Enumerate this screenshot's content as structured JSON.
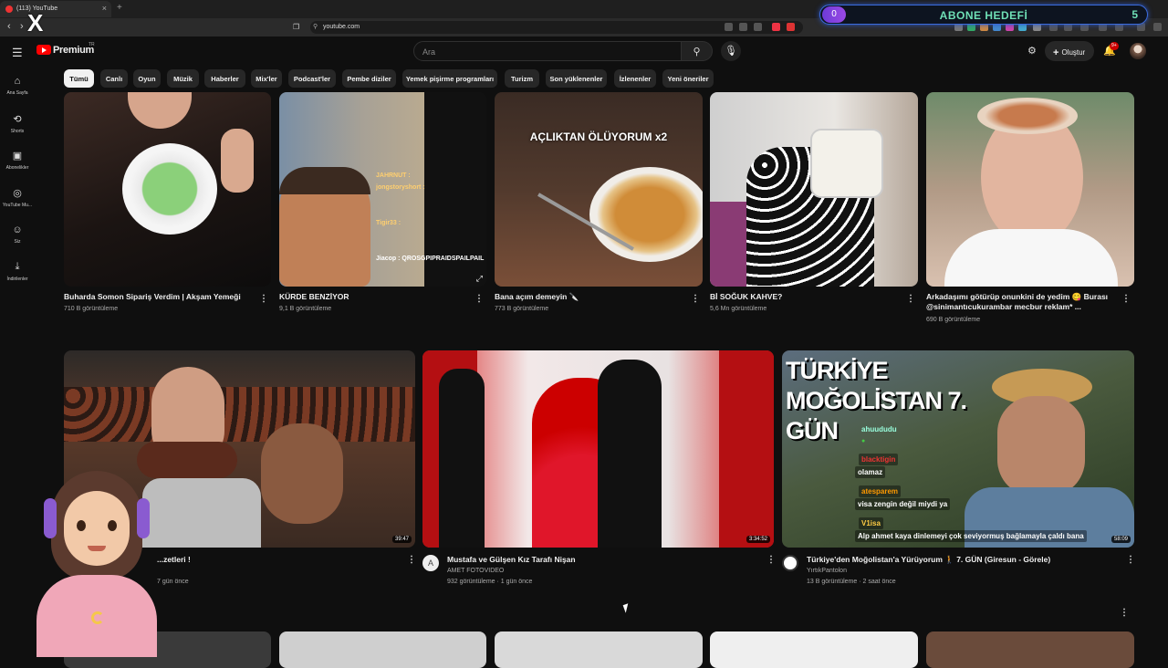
{
  "browser": {
    "tab_title": "(113) YouTube",
    "url": "youtube.com"
  },
  "overlay": {
    "goal_title": "ABONE HEDEFİ",
    "goal_current": "0",
    "goal_target": "5"
  },
  "header": {
    "logo_text": "Premium",
    "region": "TR",
    "search_placeholder": "Ara",
    "create_label": "Oluştur",
    "notification_count": "9+"
  },
  "sidebar": {
    "items": [
      {
        "label": "Ana Sayfa",
        "icon": "home-icon"
      },
      {
        "label": "Shorts",
        "icon": "shorts-icon"
      },
      {
        "label": "Abonelikler",
        "icon": "subscriptions-icon"
      },
      {
        "label": "YouTube Mu...",
        "icon": "youtube-music-icon"
      },
      {
        "label": "Siz",
        "icon": "user-icon"
      },
      {
        "label": "İndirilenler",
        "icon": "download-icon"
      }
    ]
  },
  "chips": [
    "Tümü",
    "Canlı",
    "Oyun",
    "Müzik",
    "Haberler",
    "Mix'ler",
    "Podcast'ler",
    "Pembe diziler",
    "Yemek pişirme programları",
    "Turizm",
    "Son yüklenenler",
    "İzlenenler",
    "Yeni öneriler"
  ],
  "shorts": [
    {
      "title": "Buharda Somon Sipariş Verdim | Akşam Yemeği",
      "views": "710 B görüntüleme"
    },
    {
      "title": "KÜRDE BENZİYOR",
      "views": "9,1 B görüntüleme"
    },
    {
      "title": "Bana açım demeyin 🔪",
      "views": "773 B görüntüleme",
      "overlay": "AÇLIKTAN ÖLÜYORUM x2"
    },
    {
      "title": "Bİ SOĞUK KAHVE?",
      "views": "5,6 Mn görüntüleme"
    },
    {
      "title": "Arkadaşımı götürüp onunkini de yedim 😋 Burası @sinimantıcukurambar mecbur reklam* ...",
      "views": "690 B görüntüleme"
    }
  ],
  "shorts_overlay_chat": [
    "JAHRNUT :",
    "jongstoryshort :",
    "Tigir33 :",
    "Jiacop : QROSGPIPRAIDSPAILPAIL"
  ],
  "videos": [
    {
      "title": "...zetleri !",
      "channel": "",
      "meta": "7 gün önce",
      "duration": "39:47"
    },
    {
      "title": "Mustafa ve Gülşen Kız Tarafı Nişan",
      "channel": "AMET FOTOVIDEO",
      "meta": "932 görüntüleme · 1 gün önce",
      "duration": "3:34:52"
    },
    {
      "title": "Türkiye'den Moğolistan'a Yürüyorum 🚶 7. GÜN (Giresun - Görele)",
      "channel": "YırtıkPantolon",
      "meta": "13 B görüntüleme · 2 saat önce",
      "duration": "58:09",
      "overlay_title": "TÜRKİYE MOĞOLİSTAN 7. GÜN"
    }
  ],
  "stream_chat": [
    {
      "user": "ahuududu",
      "msg": ""
    },
    {
      "user": "blacktigin",
      "msg": "olamaz"
    },
    {
      "user": "atesparem",
      "msg": "visa zengin değil miydi ya"
    },
    {
      "user": "V1isa",
      "msg": "Alp ahmet kaya dinlemeyi çok seviyormuş bağlamayla çaldı bana"
    }
  ]
}
